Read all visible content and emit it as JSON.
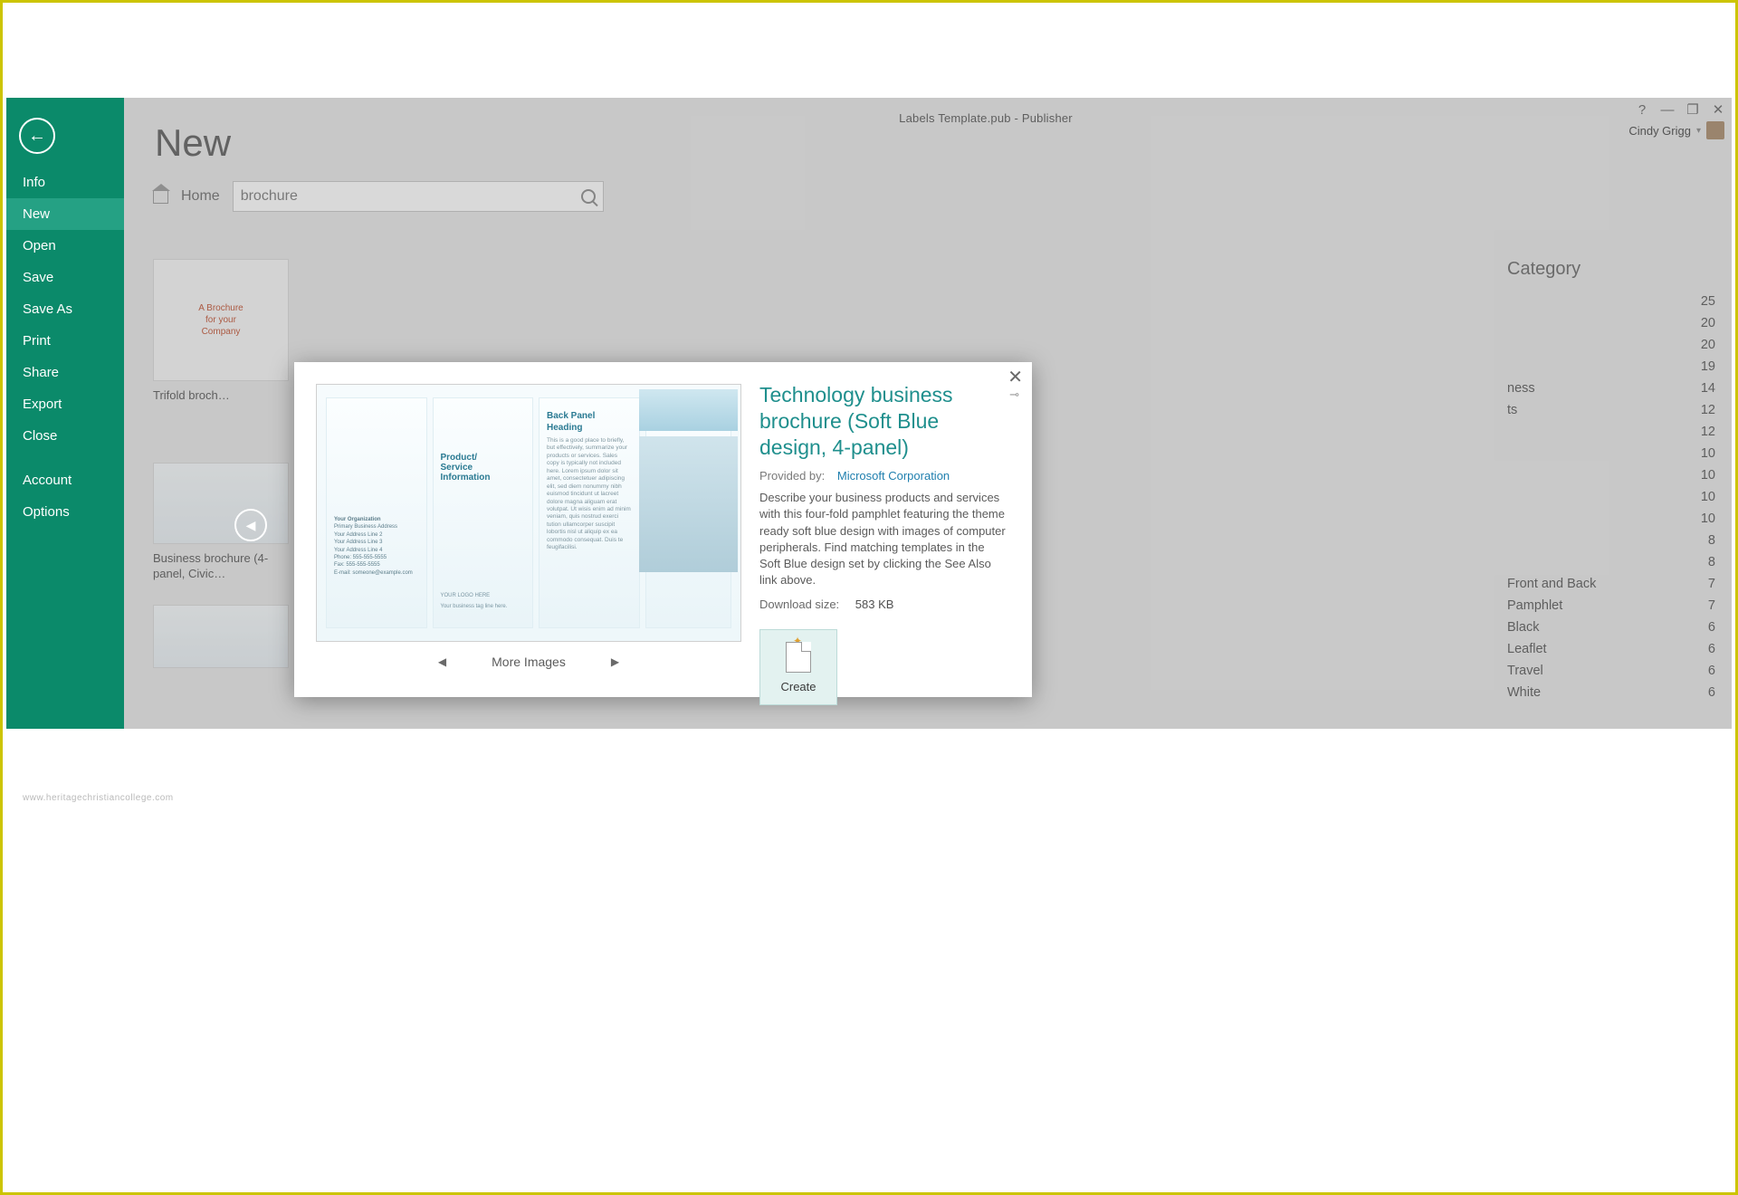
{
  "window": {
    "title": "Labels Template.pub - Publisher",
    "user": "Cindy Grigg"
  },
  "sidebar": {
    "items": [
      {
        "label": "Info",
        "active": false
      },
      {
        "label": "New",
        "active": true
      },
      {
        "label": "Open",
        "active": false
      },
      {
        "label": "Save",
        "active": false
      },
      {
        "label": "Save As",
        "active": false
      },
      {
        "label": "Print",
        "active": false
      },
      {
        "label": "Share",
        "active": false
      },
      {
        "label": "Export",
        "active": false
      },
      {
        "label": "Close",
        "active": false
      }
    ],
    "account_label": "Account",
    "options_label": "Options"
  },
  "page": {
    "title": "New",
    "home_label": "Home",
    "search_value": "brochure"
  },
  "thumbs": {
    "trifold_label": "Trifold broch…",
    "business_label": "Business brochure (4-panel, Civic…"
  },
  "categories": {
    "header": "Category",
    "rows": [
      {
        "name": "",
        "count": "25"
      },
      {
        "name": "",
        "count": "20"
      },
      {
        "name": "",
        "count": "20"
      },
      {
        "name": "",
        "count": "19"
      },
      {
        "name": "ness",
        "count": "14"
      },
      {
        "name": "ts",
        "count": "12"
      },
      {
        "name": "",
        "count": "12"
      },
      {
        "name": "",
        "count": "10"
      },
      {
        "name": "",
        "count": "10"
      },
      {
        "name": "",
        "count": "10"
      },
      {
        "name": "",
        "count": "10"
      },
      {
        "name": "",
        "count": "8"
      },
      {
        "name": "",
        "count": "8"
      },
      {
        "name": "Front and Back",
        "count": "7"
      },
      {
        "name": "Pamphlet",
        "count": "7"
      },
      {
        "name": "Black",
        "count": "6"
      },
      {
        "name": "Leaflet",
        "count": "6"
      },
      {
        "name": "Travel",
        "count": "6"
      },
      {
        "name": "White",
        "count": "6"
      }
    ]
  },
  "detail": {
    "title": "Technology business brochure (Soft Blue design, 4-panel)",
    "provided_label": "Provided by:",
    "provider": "Microsoft Corporation",
    "description": "Describe your business products and services with this four-fold pamphlet featuring the theme ready soft blue design with images of computer peripherals. Find matching templates in the Soft Blue design set by clicking the See Also link above.",
    "download_label": "Download size:",
    "download_size": "583 KB",
    "more_images": "More Images",
    "create_label": "Create",
    "preview": {
      "panel2_heading": "Product/\nService\nInformation",
      "panel3_heading": "Back Panel Heading",
      "org_name": "Your Organization",
      "addr": "Primary Business Address\nYour Address Line 2\nYour Address Line 3\nYour Address Line 4\nPhone: 555-555-5555\nFax: 555-555-5555\nE-mail: someone@example.com",
      "logo": "YOUR LOGO HERE",
      "tagline": "Your business tag line here."
    }
  },
  "watermark": "www.heritagechristiancollege.com"
}
